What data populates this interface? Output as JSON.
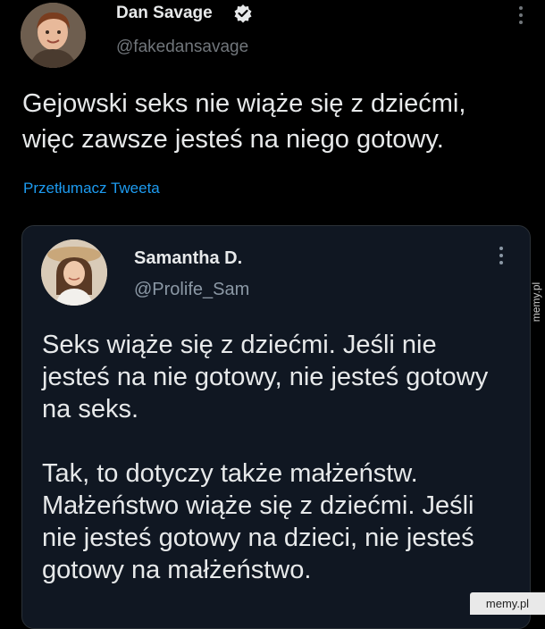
{
  "main_tweet": {
    "author_name": "Dan Savage",
    "handle": "@fakedansavage",
    "text": "Gejowski seks nie wiąże się z dziećmi, więc zawsze jesteś na niego gotowy.",
    "translate_link": "Przetłumacz Tweeta",
    "verified_icon": "verified-badge-icon",
    "more_icon": "more-vertical-icon"
  },
  "quoted_tweet": {
    "author_name": "Samantha D.",
    "handle": "@Prolife_Sam",
    "paragraph1": "Seks wiąże się z dziećmi. Jeśli nie jesteś na nie gotowy, nie jesteś gotowy na seks.",
    "paragraph2": "Tak, to dotyczy także małżeństw. Małżeństwo wiąże się z dziećmi. Jeśli nie jesteś gotowy na dzieci, nie jesteś gotowy na małżeństwo.",
    "more_icon": "more-vertical-icon"
  },
  "watermarks": {
    "side": "memy.pl",
    "corner": "memy.pl"
  },
  "colors": {
    "background": "#000000",
    "text": "#e7e9ea",
    "secondary_text": "#71767b",
    "link": "#1d9bf0",
    "quoted_card_bg": "#101722",
    "verified": "#1d9bf0"
  }
}
